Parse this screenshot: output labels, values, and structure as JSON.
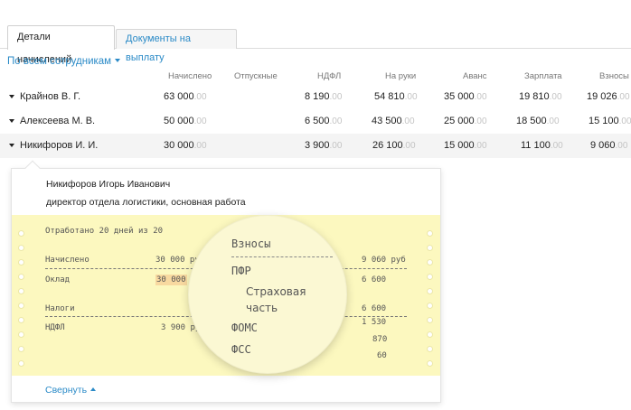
{
  "tabs": [
    {
      "label": "Детали начислений",
      "active": true
    },
    {
      "label": "Документы на выплату",
      "active": false
    }
  ],
  "filter": {
    "label": "По всем сотрудникам"
  },
  "columns": [
    "Начислено",
    "Отпускные",
    "НДФЛ",
    "На руки",
    "Аванс",
    "Зарплата",
    "Взносы"
  ],
  "rows": [
    {
      "name": "Крайнов В. Г.",
      "cells": [
        "63 000",
        "",
        "8 190",
        "54 810",
        "35 000",
        "19 810",
        "19 026"
      ],
      "cents": [
        ".00",
        "",
        ".00",
        ".00",
        ".00",
        ".00",
        ".00"
      ]
    },
    {
      "name": "Алексеева М. В.",
      "cells": [
        "50 000",
        "",
        "6 500",
        "43 500",
        "25 000",
        "18 500",
        "15 100"
      ],
      "cents": [
        ".00",
        "",
        ".00",
        ".00",
        ".00",
        ".00",
        ".00"
      ]
    },
    {
      "name": "Никифоров И. И.",
      "cells": [
        "30 000",
        "",
        "3 900",
        "26 100",
        "15 000",
        "11 100",
        "9 060"
      ],
      "cents": [
        ".00",
        "",
        ".00",
        ".00",
        ".00",
        ".00",
        ".00"
      ]
    }
  ],
  "detail": {
    "full_name": "Никифоров Игорь Иванович",
    "position": "директор отдела логистики, основная работа",
    "worked": "Отработано 20 дней из 20",
    "accrued_label": "Начислено",
    "accrued_value": "30 000 ру",
    "salary_label": "Оклад",
    "salary_value": "30 000",
    "taxes_label": "Налоги",
    "ndfl_label": "НДФЛ",
    "ndfl_value": "3 900 ру",
    "contrib_total": "9 060 руб",
    "contrib_values": [
      "6 600",
      "6 600",
      "1 530",
      "870",
      "60"
    ],
    "collapse_label": "Свернуть"
  },
  "lens": {
    "title": "Взносы",
    "pfr": "ПФР",
    "insurance_line1": "Страховая",
    "insurance_line2": "часть",
    "foms": "ФОМС",
    "fss": "ФСС"
  }
}
